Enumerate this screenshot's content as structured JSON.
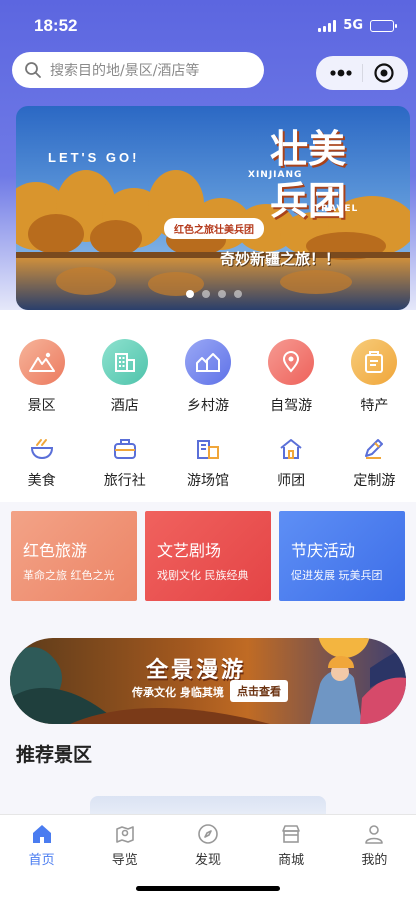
{
  "status_bar": {
    "time": "18:52",
    "network": "5G"
  },
  "search": {
    "placeholder": "搜索目的地/景区/酒店等",
    "icon": "search-icon"
  },
  "capsule": {
    "more_icon": "more-dots-icon",
    "close_icon": "target-close-icon"
  },
  "banner": {
    "slogan": "LET'S GO!",
    "title_line1": "壮美",
    "title_line2": "兵团",
    "en_line1": "XINJIANG",
    "en_line2": "TRAVEL",
    "tag": "红色之旅壮美兵团",
    "subtitle": "奇妙新疆之旅！！",
    "slide_count": 4,
    "active_slide": 1
  },
  "main_menu": [
    {
      "label": "景区",
      "icon": "mountain-icon",
      "color": "#f08a6d"
    },
    {
      "label": "酒店",
      "icon": "building-icon",
      "color": "#5fcdb6"
    },
    {
      "label": "乡村游",
      "icon": "village-icon",
      "color": "#6f85ee"
    },
    {
      "label": "自驾游",
      "icon": "map-pin-icon",
      "color": "#f2756b"
    },
    {
      "label": "特产",
      "icon": "gift-icon",
      "color": "#f3b34f"
    }
  ],
  "sub_menu": [
    {
      "label": "美食",
      "icon": "bowl-icon"
    },
    {
      "label": "旅行社",
      "icon": "suitcase-icon"
    },
    {
      "label": "游场馆",
      "icon": "venue-icon"
    },
    {
      "label": "师团",
      "icon": "house-icon"
    },
    {
      "label": "定制游",
      "icon": "pencil-icon"
    }
  ],
  "categories": [
    {
      "title": "红色旅游",
      "subtitle": "革命之旅 红色之光",
      "color": "#ef8f74"
    },
    {
      "title": "文艺剧场",
      "subtitle": "戏剧文化 民族经典",
      "color": "#ea5250"
    },
    {
      "title": "节庆活动",
      "subtitle": "促进发展 玩美兵团",
      "color": "#4a7cf0"
    }
  ],
  "promo": {
    "title": "全景漫游",
    "subtitle": "传承文化 身临其境",
    "button": "点击查看"
  },
  "section": {
    "title": "推荐景区"
  },
  "tabbar": [
    {
      "label": "首页",
      "icon": "home-icon",
      "active": true
    },
    {
      "label": "导览",
      "icon": "guide-map-icon",
      "active": false
    },
    {
      "label": "发现",
      "icon": "compass-icon",
      "active": false
    },
    {
      "label": "商城",
      "icon": "store-icon",
      "active": false
    },
    {
      "label": "我的",
      "icon": "user-icon",
      "active": false
    }
  ],
  "colors": {
    "accent": "#4a7cf0",
    "header": "#5c66e0"
  }
}
